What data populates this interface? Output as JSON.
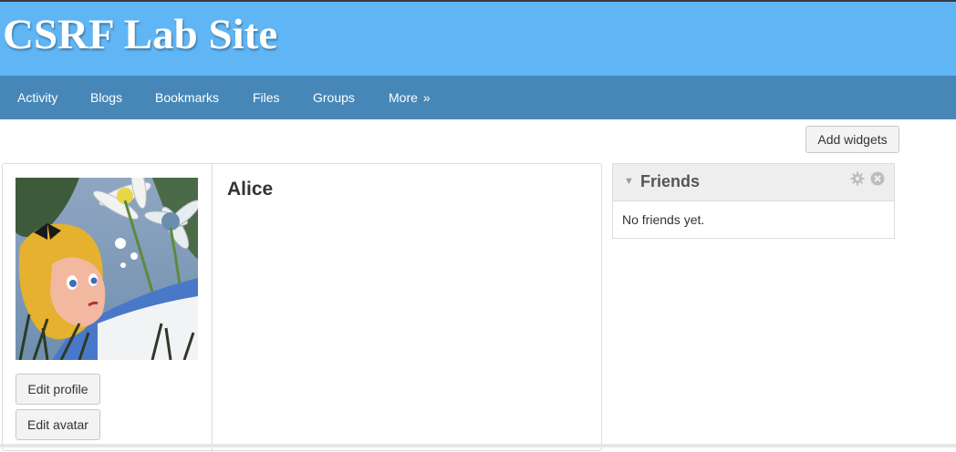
{
  "site": {
    "title": "CSRF Lab Site"
  },
  "nav": {
    "items": [
      {
        "label": "Activity"
      },
      {
        "label": "Blogs"
      },
      {
        "label": "Bookmarks"
      },
      {
        "label": "Files"
      },
      {
        "label": "Groups"
      },
      {
        "label": "More",
        "suffix": "»"
      }
    ]
  },
  "actions": {
    "add_widgets": "Add widgets"
  },
  "profile": {
    "name": "Alice",
    "edit_profile": "Edit profile",
    "edit_avatar": "Edit avatar",
    "avatar_icon": "avatar-image"
  },
  "friends_widget": {
    "title": "Friends",
    "empty_text": "No friends yet.",
    "icons": [
      "toggle-icon",
      "gear-icon",
      "close-icon"
    ]
  },
  "colors": {
    "header_bg": "#60b6f5",
    "nav_bg": "#4787b8",
    "widget_header_bg": "#eeeeee"
  }
}
